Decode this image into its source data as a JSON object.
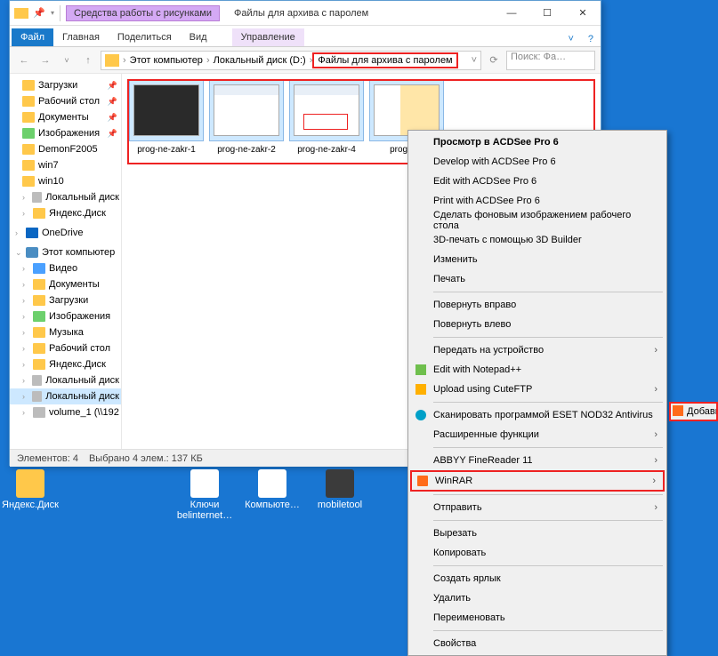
{
  "window": {
    "contextual_tab": "Средства работы с рисунками",
    "title": "Файлы для архива с паролем"
  },
  "ribbon": {
    "file": "Файл",
    "home": "Главная",
    "share": "Поделиться",
    "view": "Вид",
    "manage": "Управление"
  },
  "breadcrumbs": {
    "pc": "Этот компьютер",
    "disk": "Локальный диск (D:)",
    "folder": "Файлы для архива с паролем"
  },
  "search_placeholder": "Поиск: Фа…",
  "tree": {
    "downloads": "Загрузки",
    "desktop": "Рабочий стол",
    "documents": "Документы",
    "pictures": "Изображения",
    "demon": "DemonF2005",
    "win7": "win7",
    "win10": "win10",
    "localdisk": "Локальный диск",
    "yandex": "Яндекс.Диск",
    "onedrive": "OneDrive",
    "thispc": "Этот компьютер",
    "videos": "Видео",
    "documents2": "Документы",
    "downloads2": "Загрузки",
    "pictures2": "Изображения",
    "music": "Музыка",
    "desktop2": "Рабочий стол",
    "yandex2": "Яндекс.Диск",
    "localdisk2": "Локальный диск",
    "localdisk3": "Локальный диск",
    "volume": "volume_1 (\\\\192"
  },
  "files": {
    "f1": "prog-ne-zakr-1",
    "f2": "prog-ne-zakr-2",
    "f3": "prog-ne-zakr-4",
    "f4": "prog-ne-"
  },
  "status": {
    "elements": "Элементов: 4",
    "selected": "Выбрано 4 элем.: 137 КБ"
  },
  "ctx": {
    "view_acdsee": "Просмотр в ACDSee Pro 6",
    "develop_acdsee": "Develop with ACDSee Pro 6",
    "edit_acdsee": "Edit with ACDSee Pro 6",
    "print_acdsee": "Print with ACDSee Pro 6",
    "wallpaper": "Сделать фоновым изображением рабочего стола",
    "3dprint": "3D-печать с помощью 3D Builder",
    "edit": "Изменить",
    "print": "Печать",
    "rotate_r": "Повернуть вправо",
    "rotate_l": "Повернуть влево",
    "cast": "Передать на устройство",
    "notepadpp": "Edit with Notepad++",
    "cuteftp": "Upload using CuteFTP",
    "eset": "Сканировать программой ESET NOD32 Antivirus",
    "ext_funcs": "Расширенные функции",
    "abbyy": "ABBYY FineReader 11",
    "winrar": "WinRAR",
    "send_to": "Отправить",
    "cut": "Вырезать",
    "copy": "Копировать",
    "shortcut": "Создать ярлык",
    "delete": "Удалить",
    "rename": "Переименовать",
    "properties": "Свойства"
  },
  "submenu": {
    "add": "Добави"
  },
  "desktop": {
    "yandex": "Яндекс.Диск",
    "keys": "Ключи belinternet…",
    "computers": "Компьюте…",
    "mobiletool": "mobiletool"
  }
}
